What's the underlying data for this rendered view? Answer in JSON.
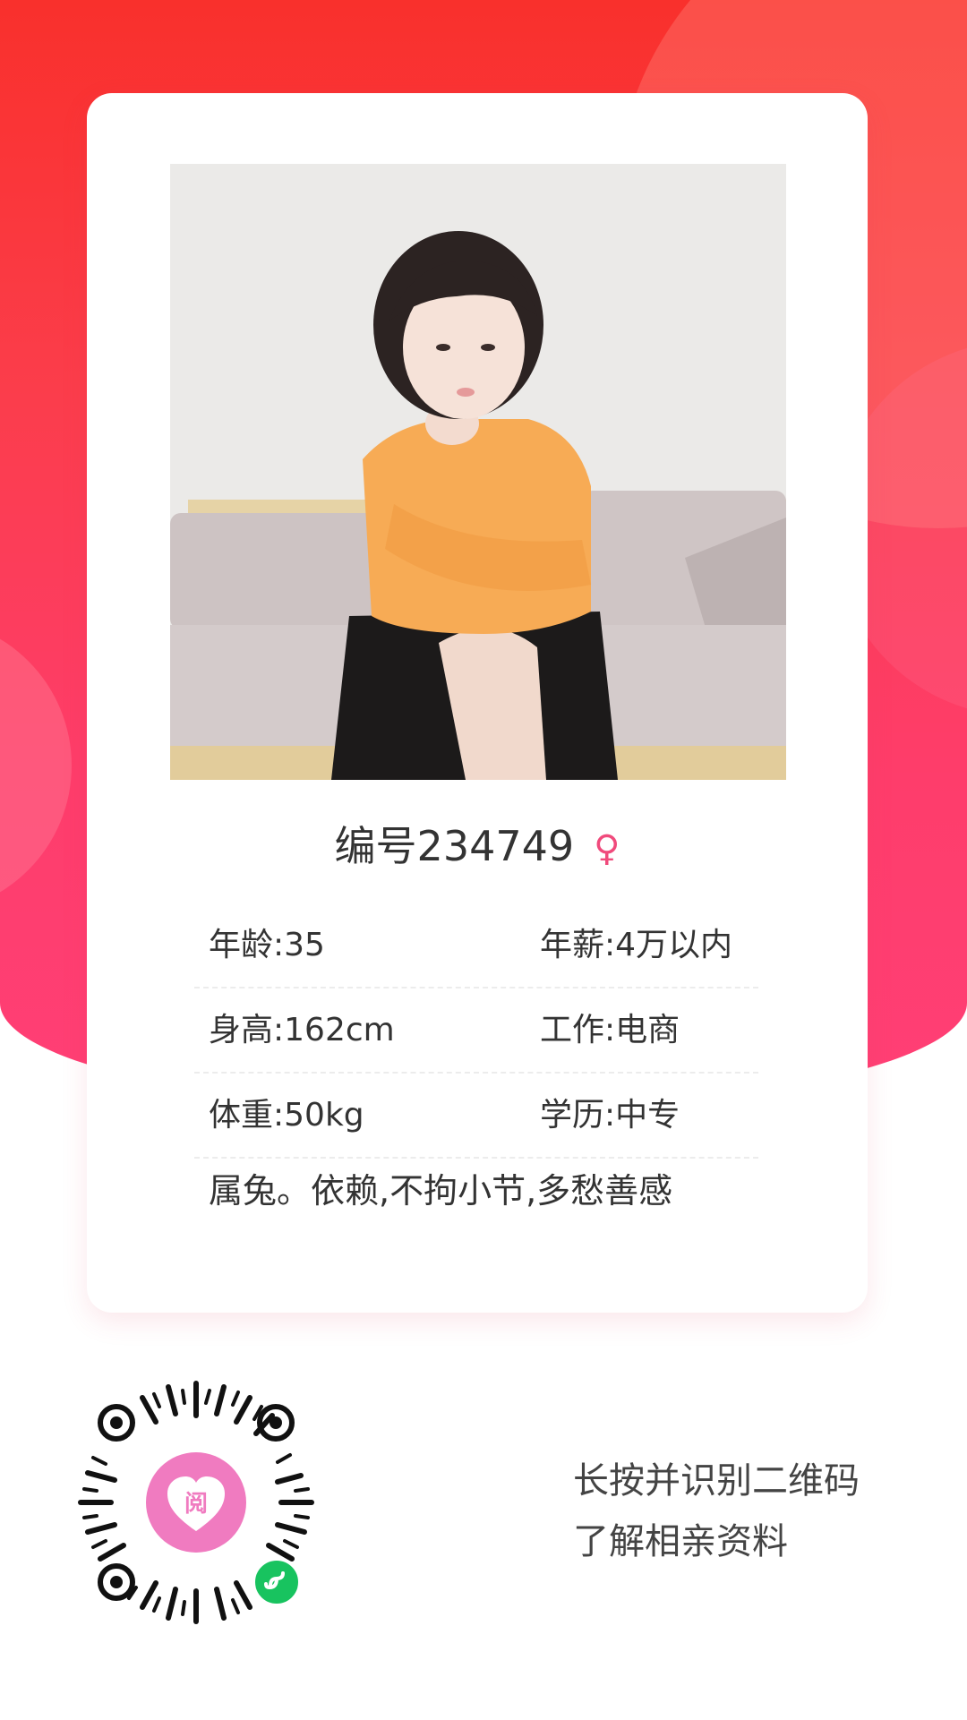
{
  "profile": {
    "id_label": "编号234749",
    "gender_symbol": "♀",
    "fields": [
      {
        "left": "年龄:35",
        "right": "年薪:4万以内"
      },
      {
        "left": "身高:162cm",
        "right": "工作:电商"
      },
      {
        "left": "体重:50kg",
        "right": "学历:中专"
      }
    ],
    "intro": "属兔。依赖,不拘小节,多愁善感"
  },
  "footer": {
    "caption_line1": "长按并识别二维码",
    "caption_line2": "了解相亲资料",
    "qr_logo_char": "阅"
  },
  "colors": {
    "accent": "#f9302c",
    "accent_bottom": "#ff3f76",
    "gender_pink": "#f04a7c",
    "qr_center": "#f07bc0",
    "mini_program_green": "#18c35f"
  }
}
